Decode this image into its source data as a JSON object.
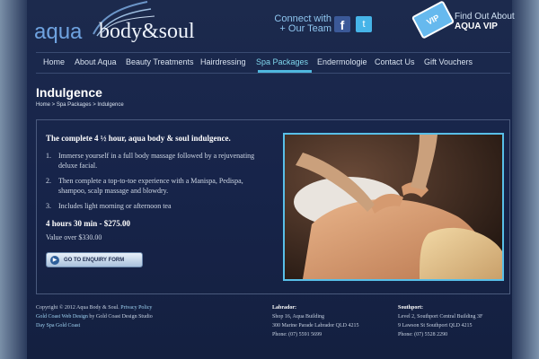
{
  "header": {
    "logo_aqua": "aqua",
    "logo_body_soul": "body&soul",
    "connect_line1": "Connect with",
    "connect_line2": "+ Our Team",
    "facebook_icon": "facebook-icon",
    "twitter_icon": "twitter-icon",
    "vip_tag": "VIP",
    "vip_line1": "Find Out About",
    "vip_line2": "AQUA VIP"
  },
  "nav": {
    "items": [
      {
        "label": "Home"
      },
      {
        "label": "About Aqua"
      },
      {
        "label": "Beauty Treatments"
      },
      {
        "label": "Hairdressing"
      },
      {
        "label": "Spa Packages"
      },
      {
        "label": "Endermologie"
      },
      {
        "label": "Contact Us"
      },
      {
        "label": "Gift Vouchers"
      }
    ],
    "active": "Spa Packages"
  },
  "page": {
    "title": "Indulgence",
    "breadcrumb": "Home > Spa Packages > Indulgence"
  },
  "content": {
    "lead": "The complete 4 ½ hour, aqua body & soul indulgence.",
    "list": [
      {
        "num": "1.",
        "text": "Immerse yourself in a full body massage followed by a rejuvenating deluxe facial."
      },
      {
        "num": "2.",
        "text": "Then complete a top-to-toe experience with a Manispa, Pedispa, shampoo, scalp massage and blowdry."
      },
      {
        "num": "3.",
        "text": "Includes light morning or afternoon tea"
      }
    ],
    "price": "4 hours 30 min - $275.00",
    "value": "Value over $330.00",
    "enquiry_button": "GO TO ENQUIRY FORM"
  },
  "footer": {
    "copyright": "Copyright © 2012 Aqua Body & Soul.",
    "privacy": "Privacy Policy",
    "web_design_link": "Gold Coast Web Design",
    "web_design_by": "by Gold Coast Design Studio",
    "day_spa": "Day Spa Gold Coast",
    "labrador": {
      "heading": "Labrador:",
      "line1": "Shop 16, Aqua Building",
      "line2": "300 Marine Parade Labrador QLD 4215",
      "phone": "Phone: (07) 5591 5699"
    },
    "southport": {
      "heading": "Southport:",
      "line1": "Level 2, Southport Central Building 3F",
      "line2": "9 Lawson St Southport QLD 4215",
      "phone": "Phone: (07) 5528 2290"
    }
  },
  "colors": {
    "accent": "#4fb8df",
    "background": "#1b2848",
    "link": "#9fd3f2"
  }
}
